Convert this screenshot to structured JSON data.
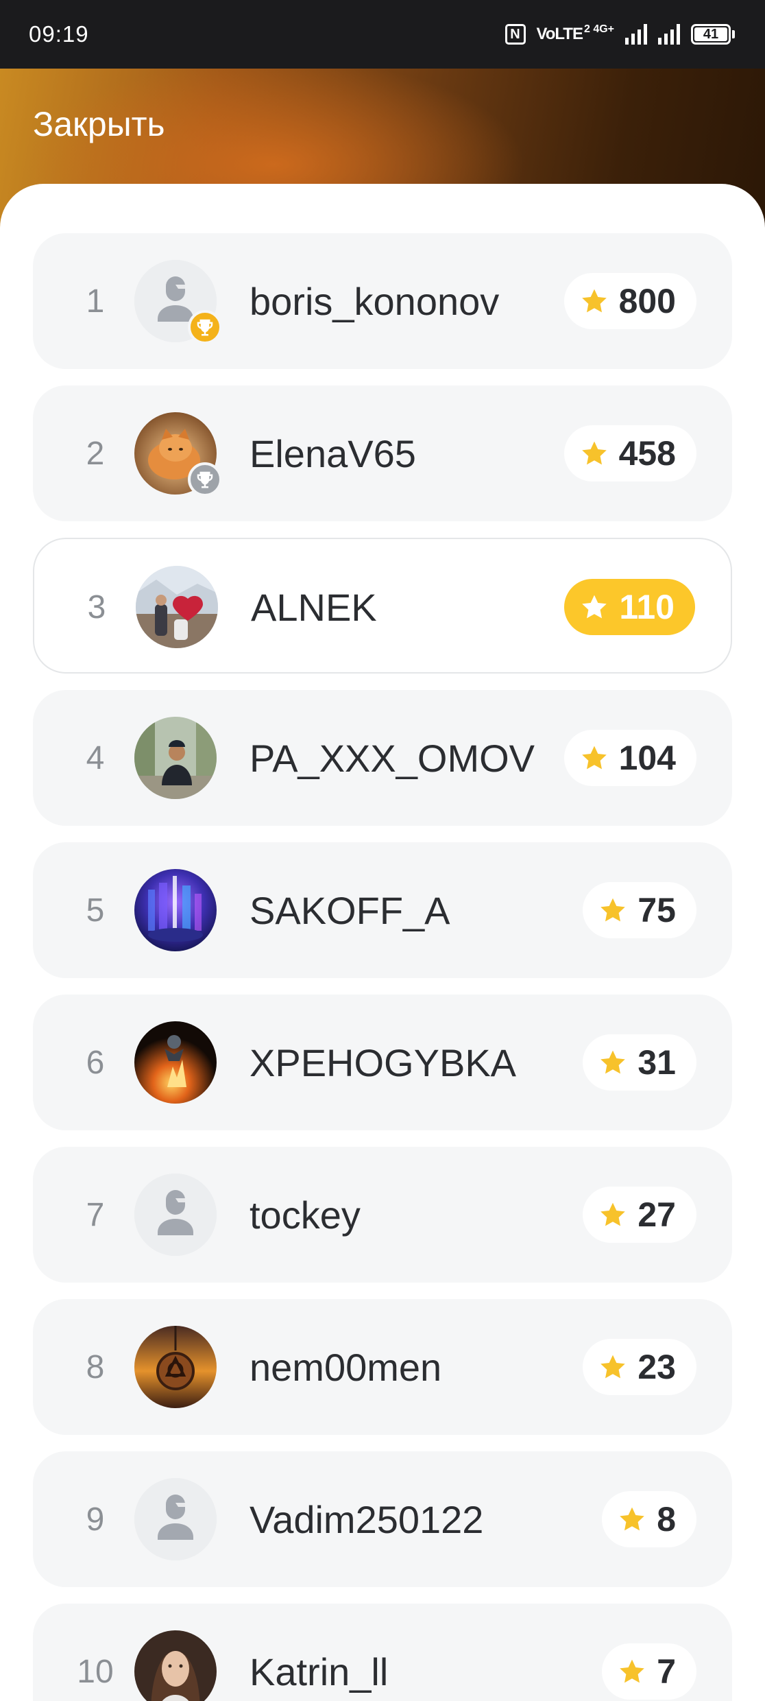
{
  "status_bar": {
    "time": "09:19",
    "network": "VoLTE",
    "network_sub": "2 4G+",
    "battery": "41"
  },
  "header": {
    "close_label": "Закрыть"
  },
  "colors": {
    "score_pill_highlight": "#fcc72a",
    "star": "#f7c22b",
    "trophy_gold": "#f4b21a",
    "trophy_silver": "#9ea3a9"
  },
  "leaderboard": [
    {
      "rank": "1",
      "username": "boris_kononov",
      "score": "800",
      "avatar": "default-user-icon",
      "trophy": "gold-trophy"
    },
    {
      "rank": "2",
      "username": "ElenaV65",
      "score": "458",
      "avatar": "cat-photo",
      "trophy": "silver-trophy"
    },
    {
      "rank": "3",
      "username": "ALNEK",
      "score": "110",
      "avatar": "heart-photo",
      "highlight": true
    },
    {
      "rank": "4",
      "username": "PA_XXX_OMOV",
      "score": "104",
      "avatar": "man-photo"
    },
    {
      "rank": "5",
      "username": "SAKOFF_A",
      "score": "75",
      "avatar": "neon-city-photo"
    },
    {
      "rank": "6",
      "username": "XPEHOGYBKA",
      "score": "31",
      "avatar": "fire-photo"
    },
    {
      "rank": "7",
      "username": "tockey",
      "score": "27",
      "avatar": "default-user-icon"
    },
    {
      "rank": "8",
      "username": "nem00men",
      "score": "23",
      "avatar": "amulet-photo"
    },
    {
      "rank": "9",
      "username": "Vadim250122",
      "score": "8",
      "avatar": "default-user-icon"
    },
    {
      "rank": "10",
      "username": "Katrin_ll",
      "score": "7",
      "avatar": "woman-photo"
    }
  ]
}
